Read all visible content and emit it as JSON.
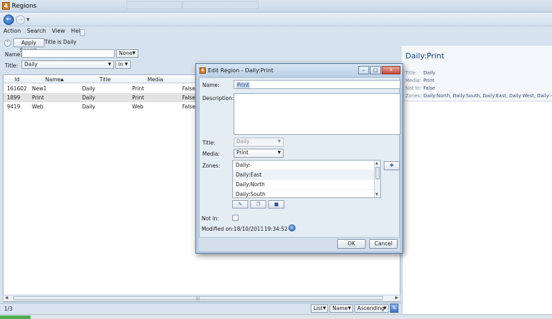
{
  "window": {
    "title": "Regions",
    "app_icon_glyph": "4"
  },
  "menu": {
    "items": [
      "Action",
      "Search",
      "View",
      "Help"
    ]
  },
  "search": {
    "apply_label": "Apply Search",
    "summary": "Title is Daily",
    "name_label": "Name:",
    "name_value": "",
    "name_op": "None",
    "title_label": "Title:",
    "title_value": "Daily",
    "title_op": "In"
  },
  "grid": {
    "columns": [
      "Id",
      "Name",
      "Title",
      "Media"
    ],
    "sort_indicator": "▲",
    "rows": [
      {
        "id": "161602",
        "name": "New1",
        "title": "Daily",
        "media": "Print",
        "not_in": "False"
      },
      {
        "id": "1899",
        "name": "Print",
        "title": "Daily",
        "media": "Print",
        "not_in": "False"
      },
      {
        "id": "9419",
        "name": "Web",
        "title": "Daily",
        "media": "Web",
        "not_in": "False"
      }
    ],
    "selected_row": 1
  },
  "status": {
    "count": "1/3",
    "view_mode": "List",
    "sort_field": "Name",
    "sort_order": "Ascending"
  },
  "detail": {
    "title": "Daily:Print",
    "fields": [
      {
        "key": "Title:",
        "value": "Daily"
      },
      {
        "key": "Media:",
        "value": "Print"
      },
      {
        "key": "Not In:",
        "value": "False"
      },
      {
        "key": "Zones:",
        "value": "Daily:North, Daily:South, Daily:East, Daily:West, Daily:-"
      }
    ]
  },
  "dialog": {
    "title": "Edit Region - Daily:Print",
    "icon_glyph": "4",
    "name_label": "Name:",
    "name_value": "Print",
    "description_label": "Description:",
    "description_value": "",
    "title_label": "Title:",
    "title_value": "Daily",
    "media_label": "Media:",
    "media_value": "Print",
    "zones_label": "Zones:",
    "zones": [
      "Daily:-",
      "Daily:East",
      "Daily:North",
      "Daily:South"
    ],
    "not_in_label": "Not in:",
    "not_in_checked": false,
    "modified_label": "Modified on:",
    "modified_date": "18/10/2011",
    "modified_time": "19:34:52",
    "ok_label": "OK",
    "cancel_label": "Cancel"
  },
  "icons": {
    "back": "back-arrow-icon",
    "forward": "forward-arrow-icon",
    "globe": "globe-icon",
    "sort": "sort-toggle-icon"
  },
  "colors": {
    "accent": "#1f5fb8",
    "detail_title": "#0f3f80",
    "selection": "#e3e3e3"
  }
}
